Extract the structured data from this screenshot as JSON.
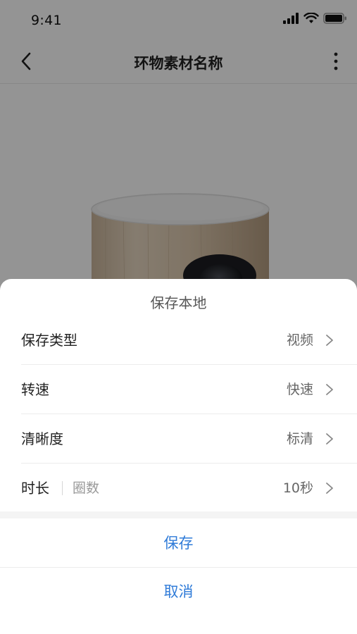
{
  "status": {
    "time": "9:41"
  },
  "nav": {
    "title": "环物素材名称",
    "back_icon": "chevron-left-icon",
    "more_icon": "more-vertical-icon"
  },
  "sheet": {
    "title": "保存本地",
    "rows": [
      {
        "label": "保存类型",
        "value": "视频"
      },
      {
        "label": "转速",
        "value": "快速"
      },
      {
        "label": "清晰度",
        "value": "标清"
      },
      {
        "label": "时长",
        "sub": "圈数",
        "value": "10秒"
      }
    ],
    "save_label": "保存",
    "cancel_label": "取消"
  },
  "colors": {
    "accent": "#2f7bd8",
    "overlay": "rgba(0,0,0,0.42)"
  }
}
